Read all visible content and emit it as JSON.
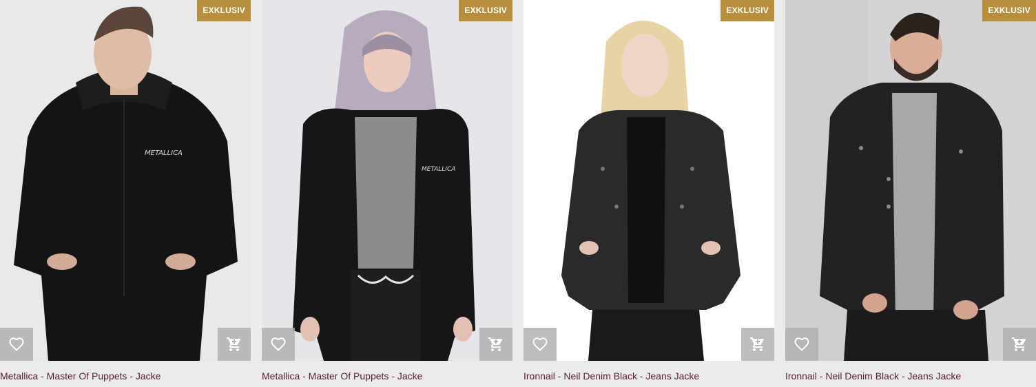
{
  "colors": {
    "page_bg": "#ebebeb",
    "badge_bg": "#b8903d",
    "product_name": "#5a1e2b",
    "action_button_bg": "#b0b0b0",
    "icon_fill": "#ffffff"
  },
  "icons": {
    "favorite": "heart-outline-icon",
    "cart": "shopping-cart-icon"
  },
  "products": [
    {
      "badge": "EXKLUSIV",
      "name": "Metallica - Master Of Puppets - Jacke"
    },
    {
      "badge": "EXKLUSIV",
      "name": "Metallica - Master Of Puppets - Jacke"
    },
    {
      "badge": "EXKLUSIV",
      "name": "Ironnail - Neil Denim Black - Jeans Jacke"
    },
    {
      "badge": "EXKLUSIV",
      "name": "Ironnail - Neil Denim Black - Jeans Jacke"
    }
  ]
}
